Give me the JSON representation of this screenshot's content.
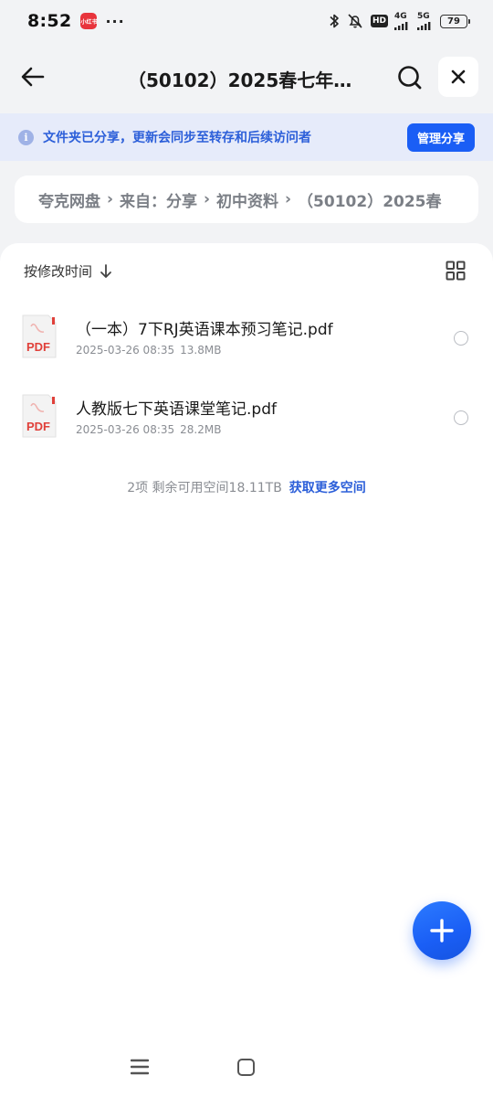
{
  "status_bar": {
    "time": "8:52",
    "app_badge": "小红书",
    "more_dots": "···",
    "hd_label": "HD",
    "network_1": "4G",
    "network_2": "5G",
    "battery": "79"
  },
  "header": {
    "title": "（50102）2025春七年级...",
    "back_icon": "arrow-left-icon",
    "search_icon": "search-icon",
    "close_icon": "close-icon"
  },
  "share_banner": {
    "info_icon_glyph": "i",
    "text": "文件夹已分享，更新会同步至转存和后续访问者",
    "button_label": "管理分享"
  },
  "breadcrumb": {
    "items": [
      "夸克网盘",
      "来自：分享",
      "初中资料",
      "（50102）2025春"
    ],
    "separator": "›"
  },
  "list": {
    "sort_label": "按修改时间",
    "files": [
      {
        "name": "（一本）7下RJ英语课本预习笔记.pdf",
        "date": "2025-03-26 08:35",
        "size": "13.8MB",
        "type_label": "PDF"
      },
      {
        "name": "人教版七下英语课堂笔记.pdf",
        "date": "2025-03-26 08:35",
        "size": "28.2MB",
        "type_label": "PDF"
      }
    ],
    "summary_text": "2项  剩余可用空间18.11TB",
    "get_space_link": "获取更多空间"
  },
  "colors": {
    "accent": "#1a5ef5",
    "banner_bg": "#e6ebfa",
    "banner_text": "#2c5fd9",
    "pdf_red": "#e0403a"
  }
}
